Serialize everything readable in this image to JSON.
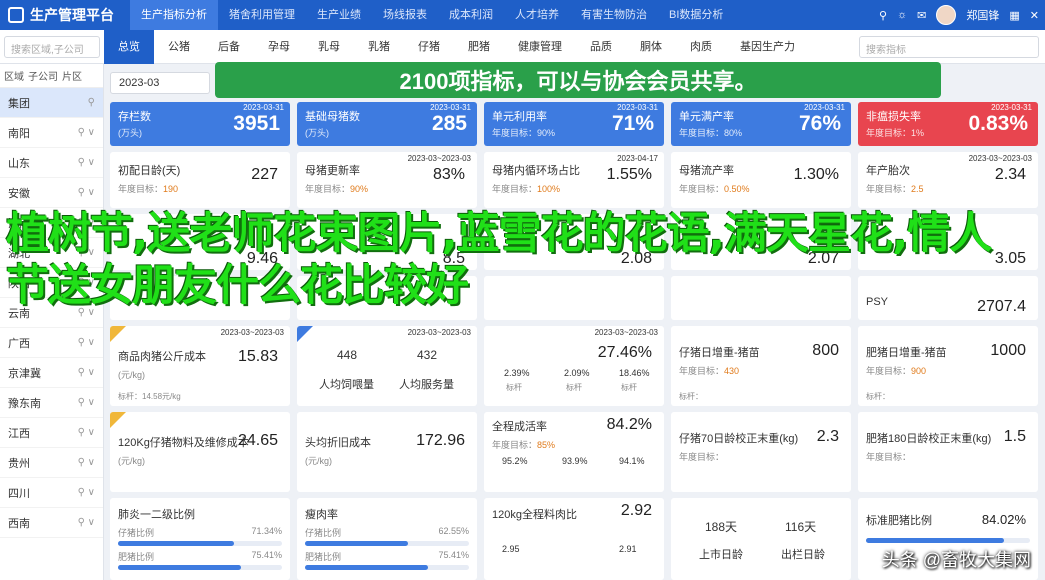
{
  "app": {
    "title": "生产管理平台"
  },
  "nav": {
    "tabs": [
      "生产指标分析",
      "猪舍利用管理",
      "生产业绩",
      "场线报表",
      "成本利润",
      "人才培养",
      "有害生物防治",
      "BI数据分析"
    ],
    "user": "郑国锋"
  },
  "subnav": {
    "search_placeholder": "搜索区域,子公司",
    "tabs": [
      "总览",
      "公猪",
      "后备",
      "孕母",
      "乳母",
      "乳猪",
      "仔猪",
      "肥猪",
      "健康管理",
      "品质",
      "胴体",
      "肉质",
      "基因生产力"
    ],
    "search2_placeholder": "搜索指标"
  },
  "sidebar": {
    "radio1": "区域",
    "radio2": "子公司",
    "radio3": "片区",
    "items": [
      "集团",
      "南阳",
      "山东",
      "安徽",
      "河南",
      "湖北",
      "陕西",
      "云南",
      "广西",
      "京津冀",
      "豫东南",
      "江西",
      "贵州",
      "四川",
      "西南"
    ]
  },
  "date": "2023-03",
  "banner": "2100项指标，可以与协会会员共享。",
  "kpis": [
    {
      "title": "存栏数",
      "sub": "(万头)",
      "value": "3951",
      "date": "2023-03-31",
      "color": "#3e7be0"
    },
    {
      "title": "基础母猪数",
      "sub": "(万头)",
      "value": "285",
      "date": "2023-03-31",
      "color": "#3e7be0"
    },
    {
      "title": "单元利用率",
      "sub": "年度目标：90%",
      "value": "71%",
      "date": "2023-03-31",
      "color": "#3e7be0"
    },
    {
      "title": "单元满产率",
      "sub": "年度目标：80%",
      "value": "76%",
      "date": "2023-03-31",
      "color": "#3e7be0"
    },
    {
      "title": "非瘟损失率",
      "sub": "年度目标：1%",
      "value": "0.83%",
      "date": "2023-03-31",
      "color": "#e8454f"
    }
  ],
  "row2": [
    {
      "title": "初配日龄(天)",
      "goal_label": "年度目标：",
      "goal": "190",
      "value": "227",
      "date": ""
    },
    {
      "title": "母猪更新率",
      "goal_label": "年度目标：",
      "goal": "90%",
      "value": "83%",
      "date": "2023-03~2023-03"
    },
    {
      "title": "母猪内循环场占比",
      "goal_label": "年度目标：",
      "goal": "100%",
      "value": "1.55%",
      "date": "2023-04-17"
    },
    {
      "title": "母猪流产率",
      "goal_label": "年度目标：",
      "goal": "0.50%",
      "value": "1.30%",
      "date": ""
    },
    {
      "title": "年产胎次",
      "goal_label": "年度目标：",
      "goal": "2.5",
      "value": "2.34",
      "date": "2023-03~2023-03"
    }
  ],
  "row3_values": [
    "9.46",
    "8.5",
    "2.08",
    "2.07",
    "3.05"
  ],
  "row4_values": [
    "",
    "",
    "",
    "",
    "2707.4"
  ],
  "row4_label": "PSY",
  "row5": [
    {
      "title": "商品肉猪公斤成本",
      "sub": "(元/kg)",
      "value": "15.83",
      "footer": "标杆：14.58元/kg",
      "date": "2023-03~2023-03"
    },
    {
      "title": "",
      "sub": "",
      "value": "",
      "footer": "",
      "date": "2023-03~2023-03"
    },
    {
      "title": "",
      "sub": "",
      "value": "27.46%",
      "footer": "",
      "date": "2023-03~2023-03"
    },
    {
      "title": "仔猪日增重-猪苗",
      "sub": "年度目标：",
      "goal": "430",
      "value": "800",
      "footer": "标杆：",
      "date": ""
    },
    {
      "title": "肥猪日增重-猪苗",
      "sub": "年度目标：",
      "goal": "900",
      "value": "1000",
      "footer": "标杆：",
      "date": ""
    }
  ],
  "people": {
    "v1": "448",
    "v2": "432",
    "l1": "人均饲喂量",
    "l2": "人均服务量"
  },
  "trio": {
    "a": "2.39%",
    "b": "2.09%",
    "c": "18.46%",
    "la": "标杆",
    "lb": "标杆",
    "lc": "标杆"
  },
  "row6": [
    {
      "title": "120Kg仔猪物料及维修成本",
      "sub": "(元/kg)",
      "value": "24.65"
    },
    {
      "title": "头均折旧成本",
      "sub": "(元/kg)",
      "value": "172.96"
    },
    {
      "title": "全程成活率",
      "sub": "年度目标：",
      "goal": "85%",
      "value": "84.2%"
    },
    {
      "title": "仔猪70日龄校正末重(kg)",
      "sub": "年度目标：",
      "goal": "",
      "value": "2.3"
    },
    {
      "title": "肥猪180日龄校正末重(kg)",
      "sub": "年度目标：",
      "goal": "",
      "value": "1.5"
    }
  ],
  "trio2": {
    "a": "95.2%",
    "b": "93.9%",
    "c": "94.1%"
  },
  "row7": [
    {
      "title": "肺炎一二级比例",
      "l1": "仔猪比例",
      "p1": "71.34%",
      "f1": 0.71,
      "l2": "肥猪比例",
      "p2": "75.41%",
      "f2": 0.75
    },
    {
      "title": "瘦肉率",
      "l1": "仔猪比例",
      "p1": "62.55%",
      "f1": 0.63,
      "l2": "肥猪比例",
      "p2": "75.41%",
      "f2": 0.75
    },
    {
      "title": "120kg全程料肉比",
      "value": "2.92",
      "a": "2.95",
      "b": "2.91"
    },
    {
      "title": "",
      "l1": "188天",
      "l2": "116天",
      "l3": "上市日龄",
      "l4": "出栏日龄"
    },
    {
      "title": "标准肥猪比例",
      "value": "84.02%",
      "f": 0.84
    }
  ],
  "overlay": "植树节,送老师花束图片,蓝雪花的花语,满天星花,情人节送女朋友什么花比较好",
  "watermark": "头条 @畜牧大集网"
}
